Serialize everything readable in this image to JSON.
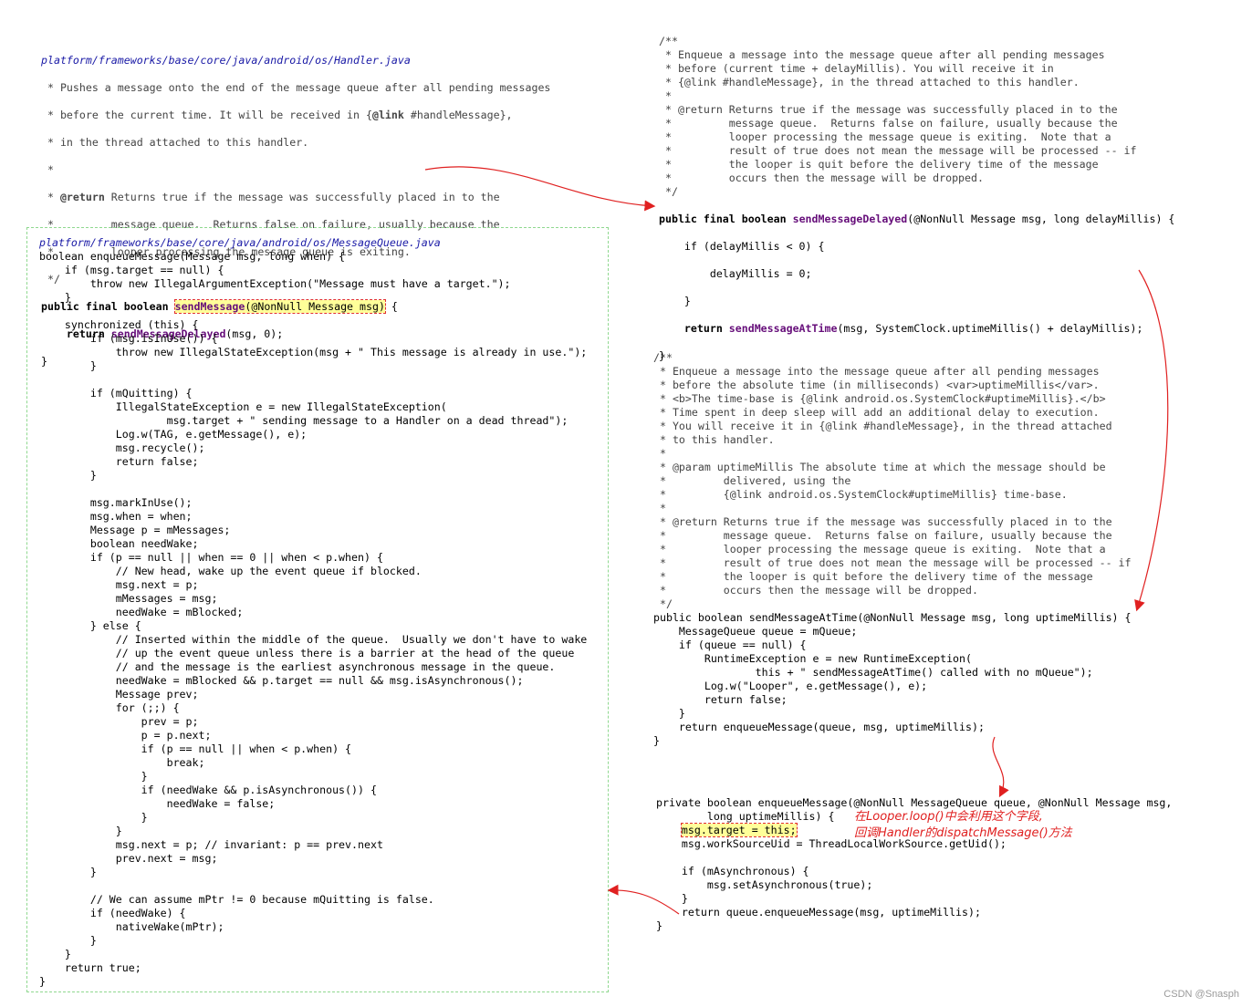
{
  "handler_block": {
    "path": "platform/frameworks/base/core/java/android/os/Handler.java",
    "l1": " * Pushes a message onto the end of the message queue after all pending messages",
    "l2": " * before the current time. It will be received in {",
    "l2_tag": "@link",
    "l2_rest": " #handleMessage},",
    "l3": " * in the thread attached to this handler.",
    "l4": " *",
    "l5_pre": " * ",
    "l5_tag": "@return",
    "l5_rest": " Returns true if the message was successfully placed in to the",
    "l6": " *         message queue.  Returns false on failure, usually because the",
    "l7": " *         looper processing the message queue is exiting.",
    "l8": " */",
    "sig_kw": "public final boolean ",
    "sig_hl": "sendMessage",
    "sig_hl_rest": "(@NonNull Message msg)",
    "sig_end": " {",
    "body_kw": "    return ",
    "body_call": "sendMessageDelayed",
    "body_rest": "(msg, 0);",
    "close": "}"
  },
  "delayed_block": {
    "lines": [
      "/**",
      " * Enqueue a message into the message queue after all pending messages",
      " * before (current time + delayMillis). You will receive it in",
      " * {@link #handleMessage}, in the thread attached to this handler.",
      " *",
      " * @return Returns true if the message was successfully placed in to the",
      " *         message queue.  Returns false on failure, usually because the",
      " *         looper processing the message queue is exiting.  Note that a",
      " *         result of true does not mean the message will be processed -- if",
      " *         the looper is quit before the delivery time of the message",
      " *         occurs then the message will be dropped.",
      " */"
    ],
    "sig_kw": "public final boolean ",
    "sig_name": "sendMessageDelayed",
    "sig_rest": "(@NonNull Message msg, long delayMillis) {",
    "if_line": "    if (delayMillis < 0) {",
    "assign_line": "        delayMillis = 0;",
    "close_if": "    }",
    "return_kw": "    return ",
    "return_call": "sendMessageAtTime",
    "return_rest": "(msg, SystemClock.uptimeMillis() + delayMillis);",
    "close": "}"
  },
  "attime_block": {
    "lines": [
      "/**",
      " * Enqueue a message into the message queue after all pending messages",
      " * before the absolute time (in milliseconds) <var>uptimeMillis</var>.",
      " * <b>The time-base is {@link android.os.SystemClock#uptimeMillis}.</b>",
      " * Time spent in deep sleep will add an additional delay to execution.",
      " * You will receive it in {@link #handleMessage}, in the thread attached",
      " * to this handler.",
      " *",
      " * @param uptimeMillis The absolute time at which the message should be",
      " *         delivered, using the",
      " *         {@link android.os.SystemClock#uptimeMillis} time-base.",
      " *",
      " * @return Returns true if the message was successfully placed in to the",
      " *         message queue.  Returns false on failure, usually because the",
      " *         looper processing the message queue is exiting.  Note that a",
      " *         result of true does not mean the message will be processed -- if",
      " *         the looper is quit before the delivery time of the message",
      " *         occurs then the message will be dropped.",
      " */"
    ],
    "code": [
      "public boolean sendMessageAtTime(@NonNull Message msg, long uptimeMillis) {",
      "    MessageQueue queue = mQueue;",
      "    if (queue == null) {",
      "        RuntimeException e = new RuntimeException(",
      "                this + \" sendMessageAtTime() called with no mQueue\");",
      "        Log.w(\"Looper\", e.getMessage(), e);",
      "        return false;",
      "    }",
      "    return enqueueMessage(queue, msg, uptimeMillis);",
      "}"
    ]
  },
  "handler_enqueue_block": {
    "code": [
      "private boolean enqueueMessage(@NonNull MessageQueue queue, @NonNull Message msg,",
      "        long uptimeMillis) {",
      "    msg.target = this;",
      "    msg.workSourceUid = ThreadLocalWorkSource.getUid();",
      "",
      "    if (mAsynchronous) {",
      "        msg.setAsynchronous(true);",
      "    }",
      "    return queue.enqueueMessage(msg, uptimeMillis);",
      "}"
    ],
    "note_1": "在Looper.loop()中会利用这个字段,",
    "note_2": "回调Handler的dispatchMessage()方法"
  },
  "mq_block": {
    "path": "platform/frameworks/base/core/java/android/os/MessageQueue.java",
    "code": [
      "boolean enqueueMessage(Message msg, long when) {",
      "    if (msg.target == null) {",
      "        throw new IllegalArgumentException(\"Message must have a target.\");",
      "    }",
      "",
      "    synchronized (this) {",
      "        if (msg.isInUse()) {",
      "            throw new IllegalStateException(msg + \" This message is already in use.\");",
      "        }",
      "",
      "        if (mQuitting) {",
      "            IllegalStateException e = new IllegalStateException(",
      "                    msg.target + \" sending message to a Handler on a dead thread\");",
      "            Log.w(TAG, e.getMessage(), e);",
      "            msg.recycle();",
      "            return false;",
      "        }",
      "",
      "        msg.markInUse();",
      "        msg.when = when;",
      "        Message p = mMessages;",
      "        boolean needWake;",
      "        if (p == null || when == 0 || when < p.when) {",
      "            // New head, wake up the event queue if blocked.",
      "            msg.next = p;",
      "            mMessages = msg;",
      "            needWake = mBlocked;",
      "        } else {",
      "            // Inserted within the middle of the queue.  Usually we don't have to wake",
      "            // up the event queue unless there is a barrier at the head of the queue",
      "            // and the message is the earliest asynchronous message in the queue.",
      "            needWake = mBlocked && p.target == null && msg.isAsynchronous();",
      "            Message prev;",
      "            for (;;) {",
      "                prev = p;",
      "                p = p.next;",
      "                if (p == null || when < p.when) {",
      "                    break;",
      "                }",
      "                if (needWake && p.isAsynchronous()) {",
      "                    needWake = false;",
      "                }",
      "            }",
      "            msg.next = p; // invariant: p == prev.next",
      "            prev.next = msg;",
      "        }",
      "",
      "        // We can assume mPtr != 0 because mQuitting is false.",
      "        if (needWake) {",
      "            nativeWake(mPtr);",
      "        }",
      "    }",
      "    return true;",
      "}"
    ]
  },
  "watermark": "CSDN @Snasph",
  "colors": {
    "arrow": "#e02020",
    "box": "#8fd88f",
    "highlight": "#ffff99"
  }
}
